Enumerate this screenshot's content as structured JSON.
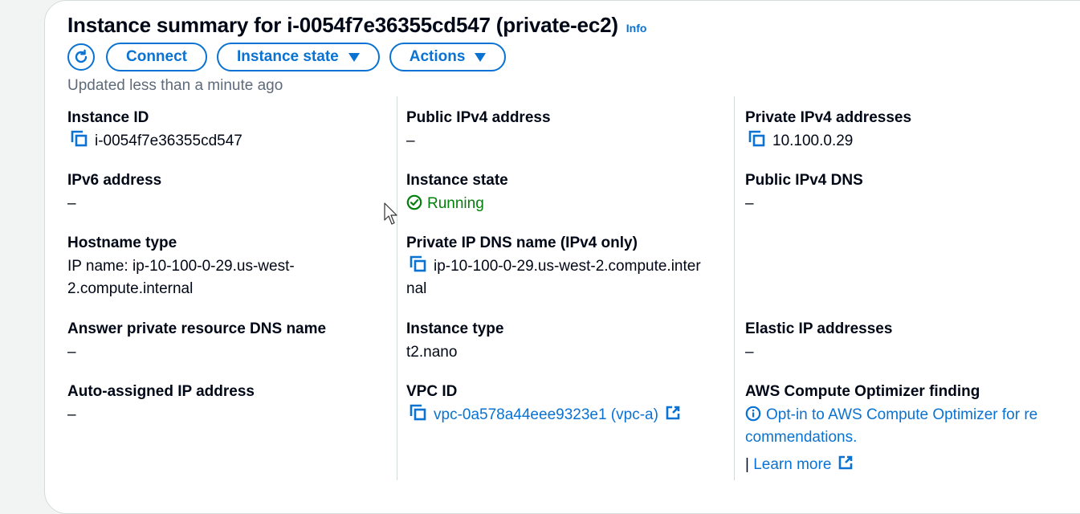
{
  "header": {
    "title": "Instance summary for i-0054f7e36355cd547 (private-ec2)",
    "info_link": "Info",
    "updated_text": "Updated less than a minute ago"
  },
  "toolbar": {
    "refresh_icon": "refresh-icon",
    "connect_label": "Connect",
    "instance_state_label": "Instance state",
    "actions_label": "Actions"
  },
  "details": {
    "instance_id": {
      "label": "Instance ID",
      "value": "i-0054f7e36355cd547"
    },
    "ipv6_address": {
      "label": "IPv6 address",
      "value": "–"
    },
    "hostname_type": {
      "label": "Hostname type",
      "value_line1": "IP name: ip-10-100-0-29.us-west-",
      "value_line2": "2.compute.internal"
    },
    "answer_private_dns": {
      "label": "Answer private resource DNS name",
      "value": "–"
    },
    "auto_assigned_ip": {
      "label": "Auto-assigned IP address",
      "value": "–"
    },
    "public_ipv4_address": {
      "label": "Public IPv4 address",
      "value": "–"
    },
    "instance_state": {
      "label": "Instance state",
      "value": "Running"
    },
    "private_ip_dns_name": {
      "label": "Private IP DNS name (IPv4 only)",
      "value_line1": "ip-10-100-0-29.us-west-2.compute.inter",
      "value_line2": "nal"
    },
    "instance_type": {
      "label": "Instance type",
      "value": "t2.nano"
    },
    "vpc_id": {
      "label": "VPC ID",
      "value": "vpc-0a578a44eee9323e1 (vpc-a)"
    },
    "private_ipv4_addresses": {
      "label": "Private IPv4 addresses",
      "value": "10.100.0.29"
    },
    "public_ipv4_dns": {
      "label": "Public IPv4 DNS",
      "value": "–"
    },
    "elastic_ip_addresses": {
      "label": "Elastic IP addresses",
      "value": "–"
    },
    "compute_optimizer": {
      "label": "AWS Compute Optimizer finding",
      "optin_line1": "Opt-in to AWS Compute Optimizer for re",
      "optin_line2": "commendations.",
      "separator": "|",
      "learn_more": "Learn more"
    }
  },
  "colors": {
    "link": "#0972d3",
    "running": "#037f0c",
    "text": "#000716",
    "muted": "#5f6b7a"
  }
}
